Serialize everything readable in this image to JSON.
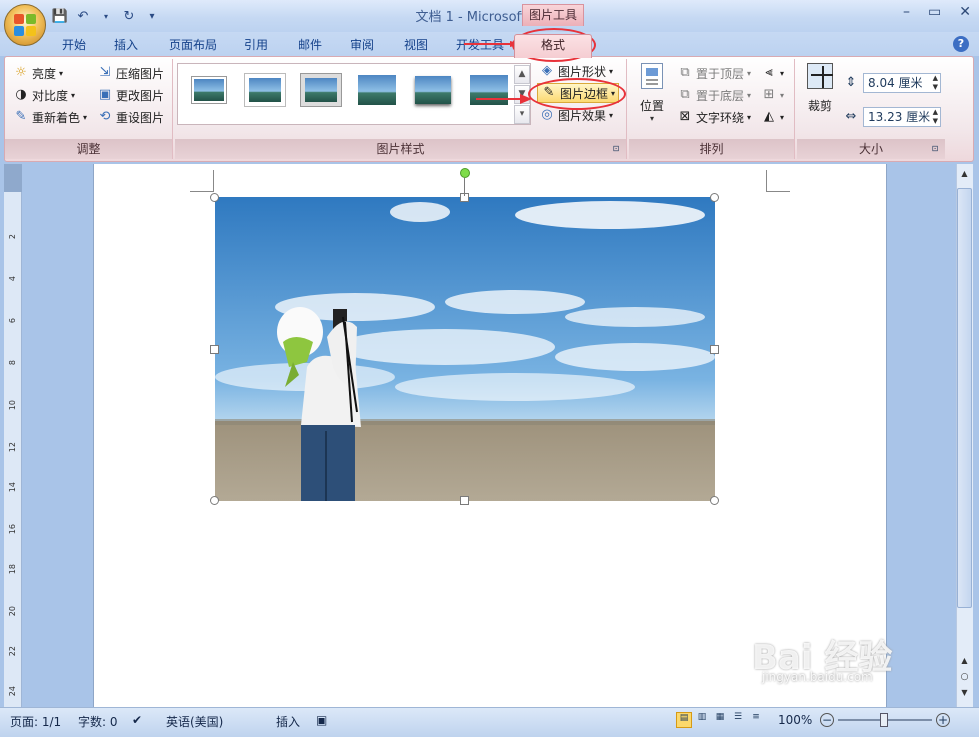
{
  "window": {
    "title": "文档 1 - Microsoft Word",
    "contextual_tool": "图片工具",
    "controls": [
      "–",
      "▭",
      "✕"
    ]
  },
  "qat": {
    "icons": [
      "save-icon",
      "undo-icon",
      "redo-icon",
      "customize-icon"
    ]
  },
  "tabs": [
    "开始",
    "插入",
    "页面布局",
    "引用",
    "邮件",
    "审阅",
    "视图",
    "开发工具"
  ],
  "active_tab": "格式",
  "help": "?",
  "ribbon": {
    "adjust": {
      "label": "调整",
      "items": [
        "亮度",
        "对比度",
        "重新着色"
      ],
      "right_items": [
        "压缩图片",
        "更改图片",
        "重设图片"
      ]
    },
    "picture_styles": {
      "label": "图片样式",
      "side": [
        "图片形状",
        "图片边框",
        "图片效果"
      ]
    },
    "arrange": {
      "label": "排列",
      "position": "位置",
      "items": [
        "置于顶层",
        "置于底层",
        "文字环绕"
      ]
    },
    "size": {
      "label": "大小",
      "crop": "裁剪",
      "height": "8.04 厘米",
      "width": "13.23 厘米"
    }
  },
  "ruler": [
    "2",
    "4",
    "6",
    "8",
    "10",
    "12",
    "14",
    "16",
    "18",
    "20",
    "22",
    "24"
  ],
  "status": {
    "page": "页面: 1/1",
    "words": "字数: 0",
    "language": "英语(美国)",
    "mode": "插入",
    "zoom": "100%"
  },
  "watermark": {
    "brand": "Bai 经验",
    "url": "jingyan.baidu.com"
  },
  "colors": {
    "accent_red": "#e8323a",
    "ribbon_pink": "#f5cdd2",
    "office_blue": "#c6d9f3"
  }
}
